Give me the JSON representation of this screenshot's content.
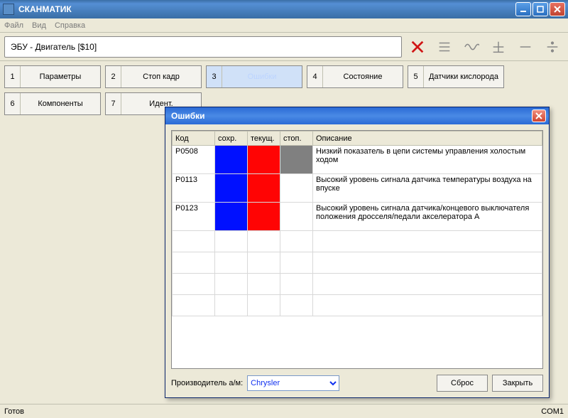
{
  "app": {
    "title": "СКАНМАТИК"
  },
  "menu": {
    "file": "Файл",
    "view": "Вид",
    "help": "Справка"
  },
  "path": "ЭБУ - Двигатель [$10]",
  "tabs": [
    {
      "num": "1",
      "label": "Параметры"
    },
    {
      "num": "2",
      "label": "Стоп кадр"
    },
    {
      "num": "3",
      "label": "Ошибки"
    },
    {
      "num": "4",
      "label": "Состояние"
    },
    {
      "num": "5",
      "label": "Датчики кислорода"
    },
    {
      "num": "6",
      "label": "Компоненты"
    },
    {
      "num": "7",
      "label": "Идент."
    }
  ],
  "status": {
    "left": "Готов",
    "right": "COM1"
  },
  "dialog": {
    "title": "Ошибки",
    "headers": {
      "code": "Код",
      "stored": "сохр.",
      "current": "текущ.",
      "stop": "стоп.",
      "desc": "Описание"
    },
    "rows": [
      {
        "code": "P0508",
        "stored": "blue",
        "current": "red",
        "stop": "gray",
        "desc": "Низкий показатель в цепи системы управления холостым ходом"
      },
      {
        "code": "P0113",
        "stored": "blue",
        "current": "red",
        "stop": "",
        "desc": "Высокий уровень сигнала датчика температуры воздуха на впуске"
      },
      {
        "code": "P0123",
        "stored": "blue",
        "current": "red",
        "stop": "",
        "desc": "Высокий уровень сигнала датчика/концевого выключателя положения дросселя/педали акселератора A"
      }
    ],
    "manufacturer_label": "Производитель а/м:",
    "manufacturer_value": "Chrysler",
    "reset": "Сброс",
    "close": "Закрыть"
  }
}
